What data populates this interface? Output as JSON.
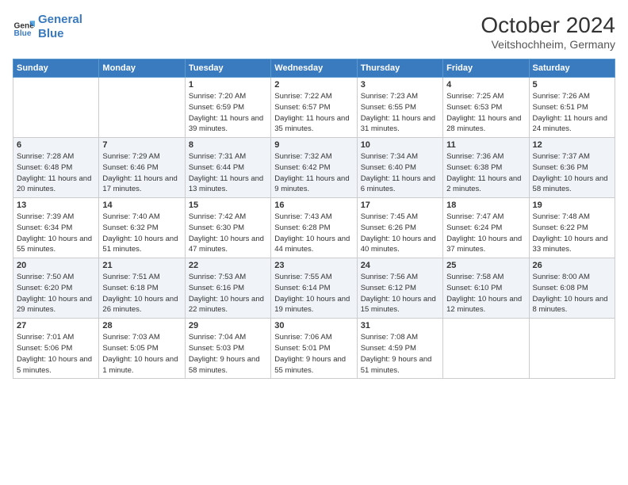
{
  "header": {
    "logo_line1": "General",
    "logo_line2": "Blue",
    "title": "October 2024",
    "subtitle": "Veitshochheim, Germany"
  },
  "days_of_week": [
    "Sunday",
    "Monday",
    "Tuesday",
    "Wednesday",
    "Thursday",
    "Friday",
    "Saturday"
  ],
  "weeks": [
    [
      {
        "day": "",
        "info": ""
      },
      {
        "day": "",
        "info": ""
      },
      {
        "day": "1",
        "info": "Sunrise: 7:20 AM\nSunset: 6:59 PM\nDaylight: 11 hours and 39 minutes."
      },
      {
        "day": "2",
        "info": "Sunrise: 7:22 AM\nSunset: 6:57 PM\nDaylight: 11 hours and 35 minutes."
      },
      {
        "day": "3",
        "info": "Sunrise: 7:23 AM\nSunset: 6:55 PM\nDaylight: 11 hours and 31 minutes."
      },
      {
        "day": "4",
        "info": "Sunrise: 7:25 AM\nSunset: 6:53 PM\nDaylight: 11 hours and 28 minutes."
      },
      {
        "day": "5",
        "info": "Sunrise: 7:26 AM\nSunset: 6:51 PM\nDaylight: 11 hours and 24 minutes."
      }
    ],
    [
      {
        "day": "6",
        "info": "Sunrise: 7:28 AM\nSunset: 6:48 PM\nDaylight: 11 hours and 20 minutes."
      },
      {
        "day": "7",
        "info": "Sunrise: 7:29 AM\nSunset: 6:46 PM\nDaylight: 11 hours and 17 minutes."
      },
      {
        "day": "8",
        "info": "Sunrise: 7:31 AM\nSunset: 6:44 PM\nDaylight: 11 hours and 13 minutes."
      },
      {
        "day": "9",
        "info": "Sunrise: 7:32 AM\nSunset: 6:42 PM\nDaylight: 11 hours and 9 minutes."
      },
      {
        "day": "10",
        "info": "Sunrise: 7:34 AM\nSunset: 6:40 PM\nDaylight: 11 hours and 6 minutes."
      },
      {
        "day": "11",
        "info": "Sunrise: 7:36 AM\nSunset: 6:38 PM\nDaylight: 11 hours and 2 minutes."
      },
      {
        "day": "12",
        "info": "Sunrise: 7:37 AM\nSunset: 6:36 PM\nDaylight: 10 hours and 58 minutes."
      }
    ],
    [
      {
        "day": "13",
        "info": "Sunrise: 7:39 AM\nSunset: 6:34 PM\nDaylight: 10 hours and 55 minutes."
      },
      {
        "day": "14",
        "info": "Sunrise: 7:40 AM\nSunset: 6:32 PM\nDaylight: 10 hours and 51 minutes."
      },
      {
        "day": "15",
        "info": "Sunrise: 7:42 AM\nSunset: 6:30 PM\nDaylight: 10 hours and 47 minutes."
      },
      {
        "day": "16",
        "info": "Sunrise: 7:43 AM\nSunset: 6:28 PM\nDaylight: 10 hours and 44 minutes."
      },
      {
        "day": "17",
        "info": "Sunrise: 7:45 AM\nSunset: 6:26 PM\nDaylight: 10 hours and 40 minutes."
      },
      {
        "day": "18",
        "info": "Sunrise: 7:47 AM\nSunset: 6:24 PM\nDaylight: 10 hours and 37 minutes."
      },
      {
        "day": "19",
        "info": "Sunrise: 7:48 AM\nSunset: 6:22 PM\nDaylight: 10 hours and 33 minutes."
      }
    ],
    [
      {
        "day": "20",
        "info": "Sunrise: 7:50 AM\nSunset: 6:20 PM\nDaylight: 10 hours and 29 minutes."
      },
      {
        "day": "21",
        "info": "Sunrise: 7:51 AM\nSunset: 6:18 PM\nDaylight: 10 hours and 26 minutes."
      },
      {
        "day": "22",
        "info": "Sunrise: 7:53 AM\nSunset: 6:16 PM\nDaylight: 10 hours and 22 minutes."
      },
      {
        "day": "23",
        "info": "Sunrise: 7:55 AM\nSunset: 6:14 PM\nDaylight: 10 hours and 19 minutes."
      },
      {
        "day": "24",
        "info": "Sunrise: 7:56 AM\nSunset: 6:12 PM\nDaylight: 10 hours and 15 minutes."
      },
      {
        "day": "25",
        "info": "Sunrise: 7:58 AM\nSunset: 6:10 PM\nDaylight: 10 hours and 12 minutes."
      },
      {
        "day": "26",
        "info": "Sunrise: 8:00 AM\nSunset: 6:08 PM\nDaylight: 10 hours and 8 minutes."
      }
    ],
    [
      {
        "day": "27",
        "info": "Sunrise: 7:01 AM\nSunset: 5:06 PM\nDaylight: 10 hours and 5 minutes."
      },
      {
        "day": "28",
        "info": "Sunrise: 7:03 AM\nSunset: 5:05 PM\nDaylight: 10 hours and 1 minute."
      },
      {
        "day": "29",
        "info": "Sunrise: 7:04 AM\nSunset: 5:03 PM\nDaylight: 9 hours and 58 minutes."
      },
      {
        "day": "30",
        "info": "Sunrise: 7:06 AM\nSunset: 5:01 PM\nDaylight: 9 hours and 55 minutes."
      },
      {
        "day": "31",
        "info": "Sunrise: 7:08 AM\nSunset: 4:59 PM\nDaylight: 9 hours and 51 minutes."
      },
      {
        "day": "",
        "info": ""
      },
      {
        "day": "",
        "info": ""
      }
    ]
  ]
}
